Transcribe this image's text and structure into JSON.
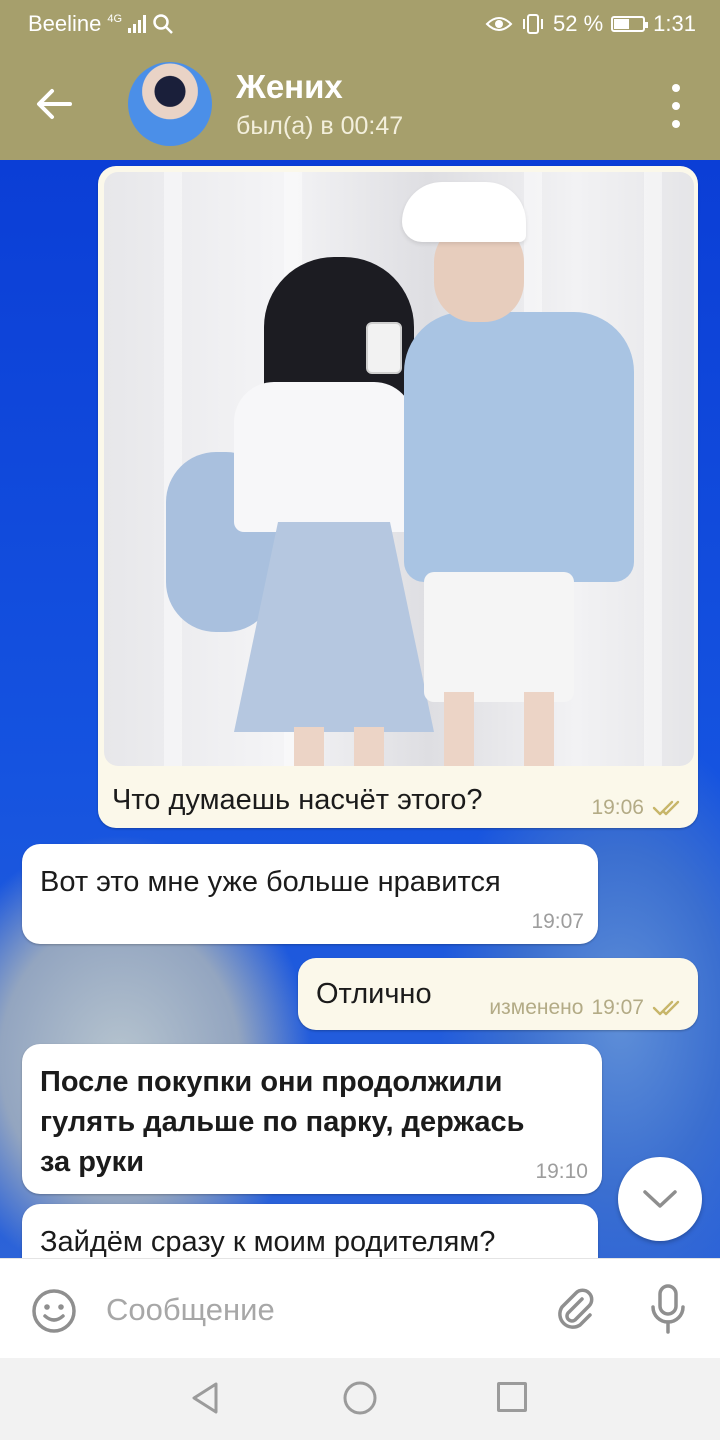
{
  "status_bar": {
    "carrier": "Beeline",
    "network": "4G",
    "battery": "52 %",
    "battery_level": 0.52,
    "time": "1:31"
  },
  "header": {
    "title": "Жених",
    "status": "был(а) в 00:47",
    "icons": [
      "back-arrow-icon",
      "avatar",
      "more-vert-icon"
    ]
  },
  "messages": [
    {
      "direction": "out",
      "has_photo": true,
      "text": "Что думаешь насчёт этого?",
      "time": "19:06",
      "read": true
    },
    {
      "direction": "in",
      "text": "Вот это мне уже больше нравится",
      "time": "19:07"
    },
    {
      "direction": "out",
      "text": "Отлично",
      "edited_label": "изменено",
      "time": "19:07",
      "read": true
    },
    {
      "direction": "in",
      "bold": true,
      "text_lines": [
        "После покупки они продолжили",
        "гулять дальше по парку, держась",
        "за руки"
      ],
      "time": "19:10"
    },
    {
      "direction": "in",
      "text": "Зайдём сразу к моим родителям?"
    }
  ],
  "composer": {
    "placeholder": "Сообщение",
    "icons": [
      "emoji-icon",
      "paperclip-icon",
      "microphone-icon"
    ]
  },
  "colors": {
    "header": "#a69f6c",
    "outgoing_bubble": "#fbf8ea",
    "incoming_bubble": "#ffffff",
    "check_marks": "#c7b66a"
  }
}
